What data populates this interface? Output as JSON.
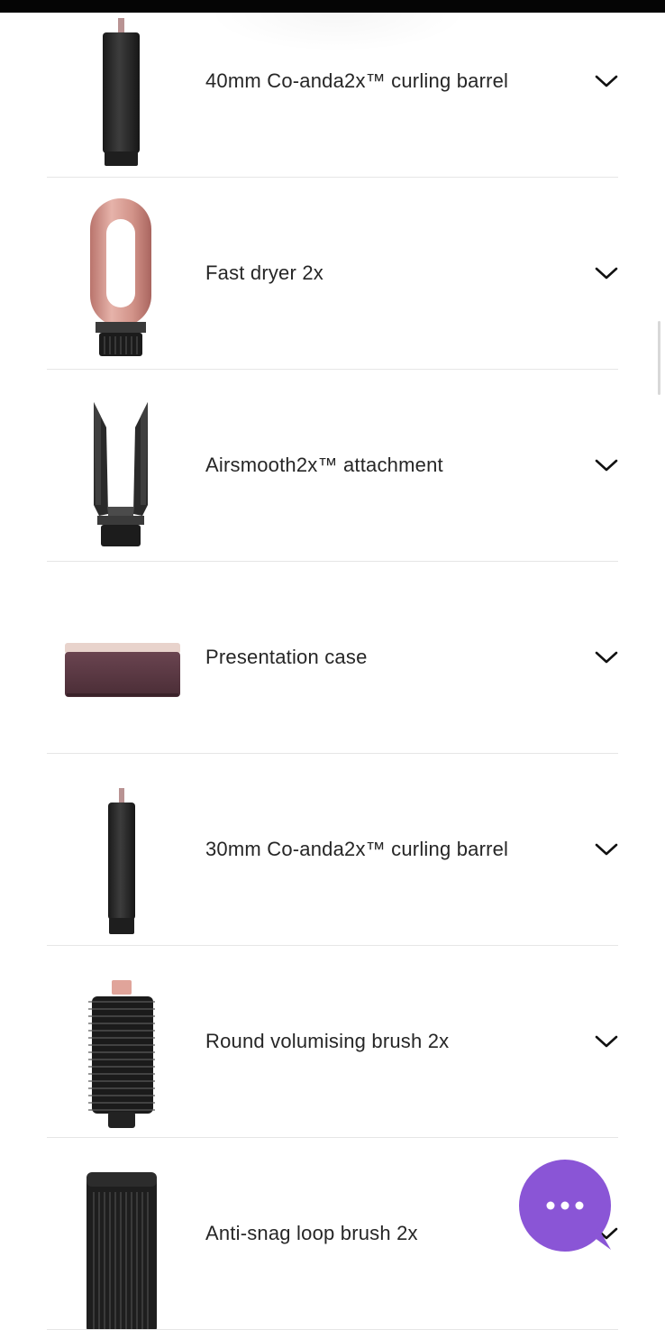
{
  "accessories": [
    {
      "label": "40mm Co-anda2x™ curling barrel",
      "icon": "curling-barrel-40mm-image"
    },
    {
      "label": "Fast dryer 2x",
      "icon": "fast-dryer-image"
    },
    {
      "label": "Airsmooth2x™ attachment",
      "icon": "airsmooth-attachment-image"
    },
    {
      "label": "Presentation case",
      "icon": "presentation-case-image"
    },
    {
      "label": "30mm Co-anda2x™ curling barrel",
      "icon": "curling-barrel-30mm-image"
    },
    {
      "label": "Round volumising brush 2x",
      "icon": "round-volumising-brush-image"
    },
    {
      "label": "Anti-snag loop brush 2x",
      "icon": "anti-snag-loop-brush-image"
    }
  ],
  "chevron_icon": "chevron-down-icon",
  "chat": {
    "icon": "chat-bubble-icon",
    "color": "#8a55d6"
  },
  "colors": {
    "text": "#262626",
    "divider": "#e6e6e6",
    "rose_gold": "#d9a39a",
    "graphite": "#2a2a2a",
    "plum": "#5e3a45"
  }
}
